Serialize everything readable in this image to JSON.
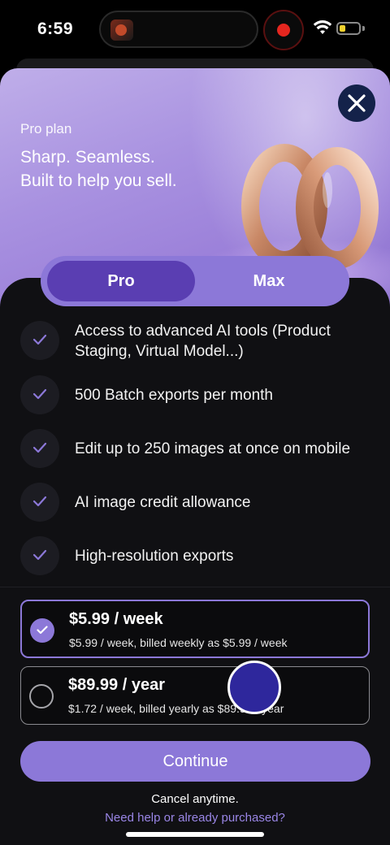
{
  "status_bar": {
    "time": "6:59",
    "battery_level": 0.3,
    "icons": [
      "wifi-icon",
      "battery-icon",
      "record-icon"
    ]
  },
  "hero": {
    "label": "Pro plan",
    "title_line1": "Sharp. Seamless.",
    "title_line2": "Built to help you sell.",
    "close_icon": "close-icon"
  },
  "tabs": {
    "pro": "Pro",
    "max": "Max",
    "selected": "Pro"
  },
  "features": [
    {
      "line1": "Access to advanced AI tools (Product",
      "line2": "Staging, Virtual Model...)"
    },
    {
      "line1": "500 Batch exports per month"
    },
    {
      "line1": "Edit up to 250 images at once on mobile"
    },
    {
      "line1": "AI image credit allowance"
    },
    {
      "line1": "High-resolution exports"
    }
  ],
  "plans": [
    {
      "price": "$5.99 / week",
      "detail": "$5.99 / week, billed weekly as $5.99 / week",
      "selected": true
    },
    {
      "price": "$89.99 / year",
      "detail": "$1.72 / week, billed yearly as $89.99 / year",
      "selected": false
    }
  ],
  "continue_label": "Continue",
  "cancel_text": "Cancel anytime.",
  "help_link": "Need help or already purchased?",
  "colors": {
    "accent": "#8c78d8",
    "accent_dark": "#5a3eb2",
    "background": "#101013",
    "link": "#9a86e6"
  }
}
